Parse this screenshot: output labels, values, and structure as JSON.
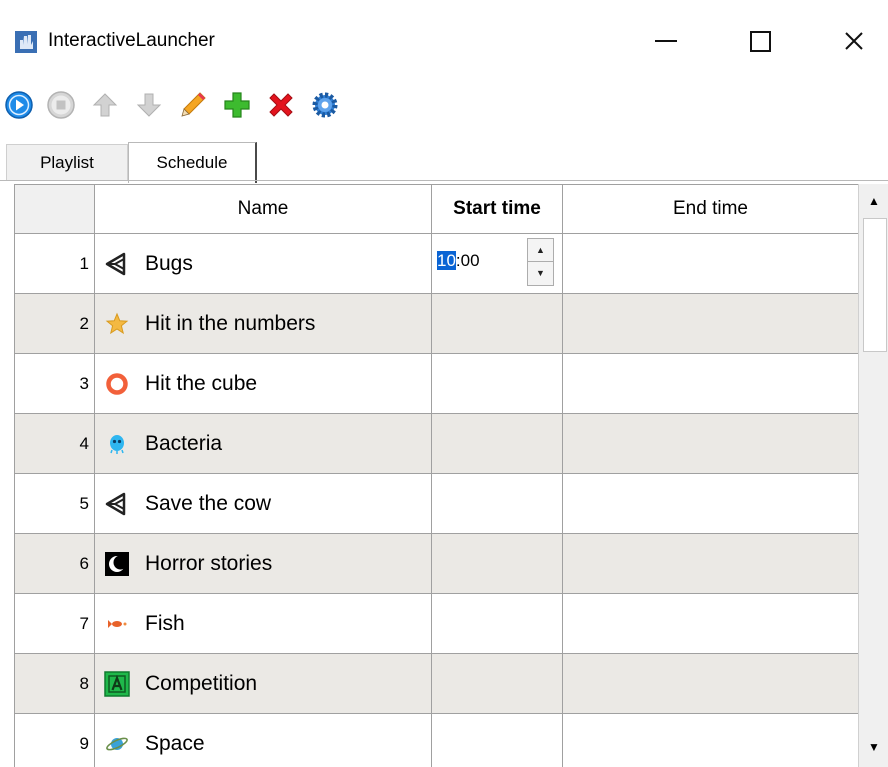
{
  "window": {
    "title": "InteractiveLauncher",
    "icons": {
      "app": "app-logo-icon",
      "minimize": "minimize-icon",
      "maximize": "maximize-icon",
      "close": "close-icon"
    }
  },
  "toolbar": {
    "buttons": [
      {
        "name": "play-button",
        "icon": "play-icon",
        "color": "#1e8be8"
      },
      {
        "name": "stop-button",
        "icon": "stop-icon",
        "color": "#c8c8c8"
      },
      {
        "name": "move-up-button",
        "icon": "arrow-up-icon",
        "color": "#c4c4c4"
      },
      {
        "name": "move-down-button",
        "icon": "arrow-down-icon",
        "color": "#c4c4c4"
      },
      {
        "name": "edit-button",
        "icon": "pencil-icon",
        "color": "#f5a623"
      },
      {
        "name": "add-button",
        "icon": "plus-icon",
        "color": "#3dbb2f"
      },
      {
        "name": "delete-button",
        "icon": "x-icon",
        "color": "#e3141e"
      },
      {
        "name": "settings-button",
        "icon": "gear-icon",
        "color": "#2f7fd6"
      }
    ]
  },
  "tabs": [
    {
      "label": "Playlist",
      "active": false
    },
    {
      "label": "Schedule",
      "active": true
    }
  ],
  "grid": {
    "columns": {
      "num": "",
      "name": "Name",
      "start": "Start time",
      "end": "End time"
    },
    "editor": {
      "selected": "10",
      "rest": ":00"
    },
    "rows": [
      {
        "num": "1",
        "name": "Bugs",
        "icon": "unity-icon"
      },
      {
        "num": "2",
        "name": "Hit in the numbers",
        "icon": "star-icon"
      },
      {
        "num": "3",
        "name": "Hit the cube",
        "icon": "ring-icon"
      },
      {
        "num": "4",
        "name": "Bacteria",
        "icon": "bacteria-icon"
      },
      {
        "num": "5",
        "name": "Save the cow",
        "icon": "unity-icon"
      },
      {
        "num": "6",
        "name": "Horror stories",
        "icon": "moon-icon"
      },
      {
        "num": "7",
        "name": "Fish",
        "icon": "fish-icon"
      },
      {
        "num": "8",
        "name": "Competition",
        "icon": "letter-a-icon"
      },
      {
        "num": "9",
        "name": "Space",
        "icon": "planet-icon"
      }
    ]
  },
  "colors": {
    "accent": "#0a64d4",
    "alt_row": "#ebe9e5",
    "header_bg": "#f0f0f0"
  }
}
